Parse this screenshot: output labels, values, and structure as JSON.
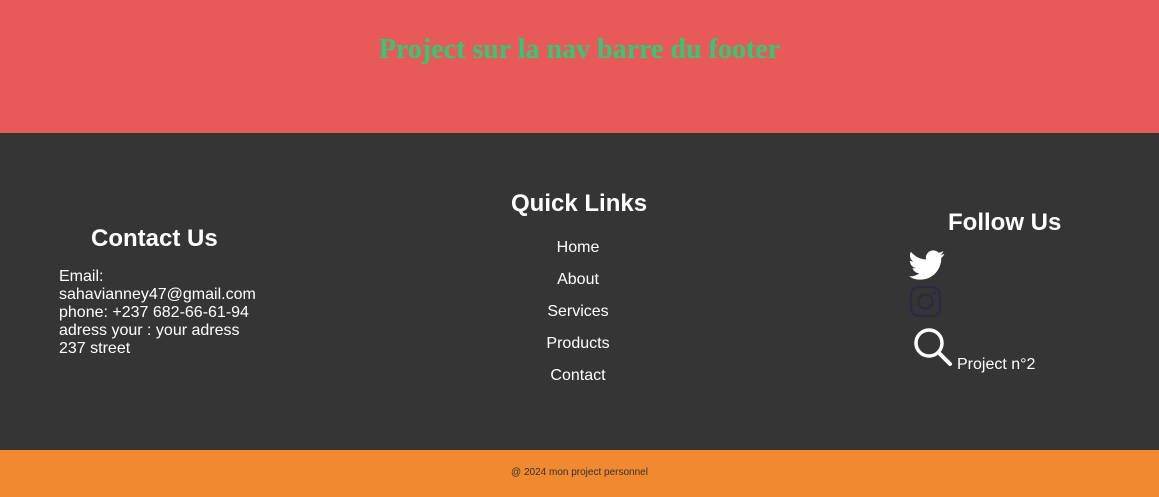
{
  "banner": {
    "title": "Project sur la nav barre du footer",
    "background": "#e85a5a",
    "title_color": "#2ecc71"
  },
  "footer": {
    "background": "#353535",
    "contact": {
      "title": "Contact Us",
      "email_label": "Email:",
      "email": "sahavianney47@gmail.com",
      "phone": "phone: +237 682-66-61-94",
      "address": "adress your : your adress",
      "street": "237 street"
    },
    "quick_links": {
      "title": "Quick Links",
      "items": [
        {
          "label": "Home"
        },
        {
          "label": "About"
        },
        {
          "label": "Services"
        },
        {
          "label": "Products"
        },
        {
          "label": "Contact"
        }
      ]
    },
    "follow": {
      "title": "Follow Us",
      "icons": [
        "twitter-icon",
        "instagram-icon",
        "search-icon"
      ],
      "project_link": "Project n°2"
    }
  },
  "bottom_bar": {
    "copyright": "@ 2024 mon project personnel",
    "background": "#f0892f"
  }
}
